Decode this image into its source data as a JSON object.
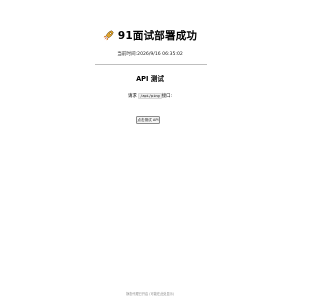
{
  "header": {
    "logo_icon": "rocket-icon",
    "title": "91面试部署成功"
  },
  "status": {
    "time_label": "当前时间:",
    "time_value": "2026/9/16 06:35:02"
  },
  "api_test": {
    "title": "API 测试",
    "request_prefix": "请求",
    "request_path": "/api/ping",
    "request_suffix": "接口:",
    "button_label": "点击测试 API"
  },
  "footer": {
    "text": "静态代理已开启 (可能在此处显示)"
  }
}
